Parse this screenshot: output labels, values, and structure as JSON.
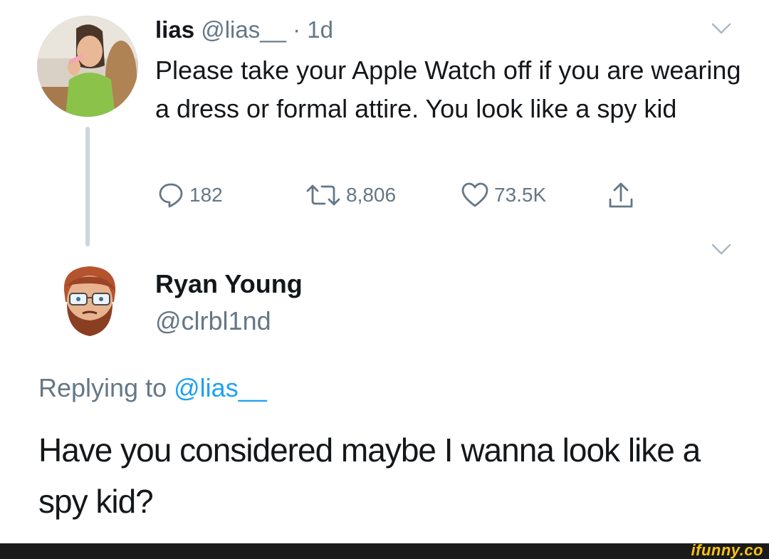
{
  "tweet": {
    "display_name": "lias",
    "handle": "@lias__",
    "separator": "·",
    "time": "1d",
    "text": "Please take your Apple Watch off if you are wearing a dress or formal attire. You look like a spy kid",
    "actions": {
      "reply": {
        "icon": "reply-icon",
        "count": "182"
      },
      "retweet": {
        "icon": "retweet-icon",
        "count": "8,806"
      },
      "like": {
        "icon": "heart-icon",
        "count": "73.5K"
      },
      "share": {
        "icon": "share-icon"
      }
    }
  },
  "reply": {
    "display_name": "Ryan Young",
    "handle": "@clrbl1nd",
    "replying_prefix": "Replying to",
    "replying_to": "@lias__",
    "text": "Have you considered maybe I wanna look like a spy kid?"
  },
  "watermark": {
    "text": "ifunny.co"
  },
  "colors": {
    "text_primary": "#14171a",
    "text_secondary": "#657786",
    "link": "#1da1f2",
    "thread_line": "#ccd6dd",
    "watermark_bar": "#1b1b1b",
    "watermark_text": "#f7c21b"
  }
}
